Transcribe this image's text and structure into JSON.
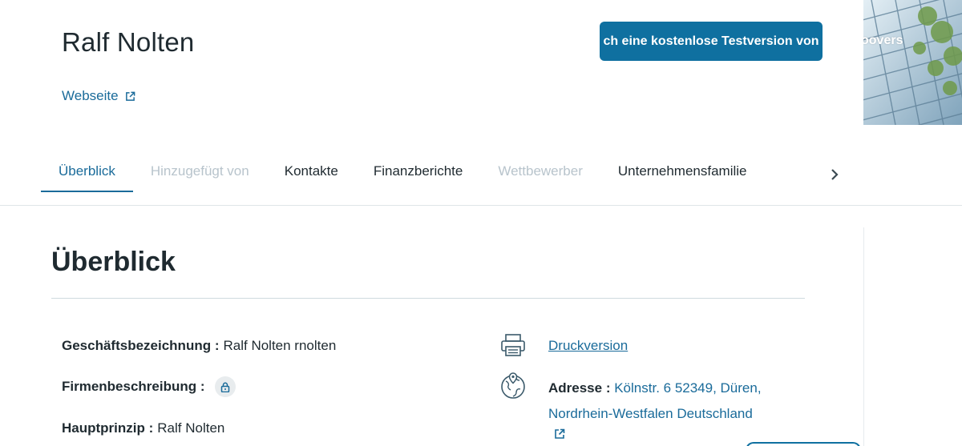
{
  "company": {
    "name": "Ralf Nolten",
    "website_label": "Webseite"
  },
  "cta": {
    "trial_label": "ch eine kostenlose Testversion von",
    "hero_overlay": "oovers"
  },
  "tabs": [
    {
      "label": "Überblick",
      "state": "active"
    },
    {
      "label": "Hinzugefügt von",
      "state": "disabled"
    },
    {
      "label": "Kontakte",
      "state": "normal"
    },
    {
      "label": "Finanzberichte",
      "state": "normal"
    },
    {
      "label": "Wettbewerber",
      "state": "disabled"
    },
    {
      "label": "Unternehmensfamilie",
      "state": "normal"
    }
  ],
  "overview": {
    "title": "Überblick",
    "fields": {
      "business_name": {
        "label": "Geschäftsbezeichnung :",
        "value": "Ralf Nolten rnolten"
      },
      "description": {
        "label": "Firmenbeschreibung :"
      },
      "principal": {
        "label": "Hauptprinzip :",
        "value": "Ralf Nolten"
      }
    },
    "print_label": "Druckversion",
    "address": {
      "label": "Adresse :",
      "value": "Kölnstr. 6 52349, Düren, Nordrhein-Westfalen Deutschland"
    }
  },
  "colors": {
    "accent": "#1a6b9a",
    "button": "#0f70a0",
    "text": "#1f2a30",
    "disabled": "#b8c4cc"
  },
  "icons": [
    "external-link-icon",
    "chevron-right-icon",
    "lock-icon",
    "printer-icon",
    "globe-location-icon"
  ]
}
